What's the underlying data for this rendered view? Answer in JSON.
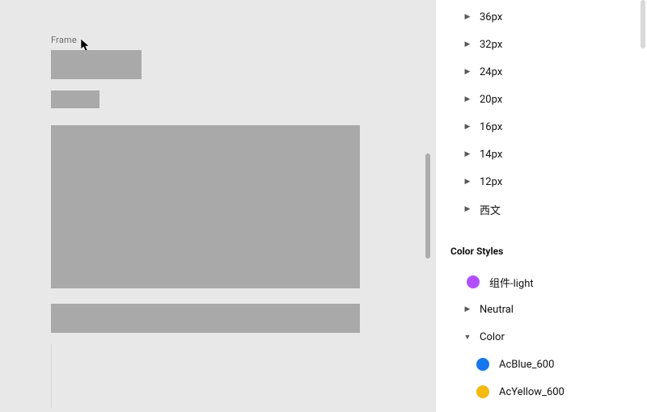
{
  "canvas": {
    "frame_label": "Frame"
  },
  "panel": {
    "spacing_items": [
      "36px",
      "32px",
      "24px",
      "20px",
      "16px",
      "14px",
      "12px",
      "西文"
    ],
    "color_section_title": "Color Styles",
    "color_items": [
      {
        "label": "组件-light",
        "swatch": "swatch-purple",
        "expandable": false
      },
      {
        "label": "Neutral",
        "swatch": null,
        "expandable": true,
        "expanded": false
      },
      {
        "label": "Color",
        "swatch": null,
        "expandable": true,
        "expanded": true
      },
      {
        "label": "AcBlue_600",
        "swatch": "swatch-blue",
        "expandable": false,
        "indent": 2
      },
      {
        "label": "AcYellow_600",
        "swatch": "swatch-yellow",
        "expandable": false,
        "indent": 2,
        "truncated": true
      }
    ]
  }
}
